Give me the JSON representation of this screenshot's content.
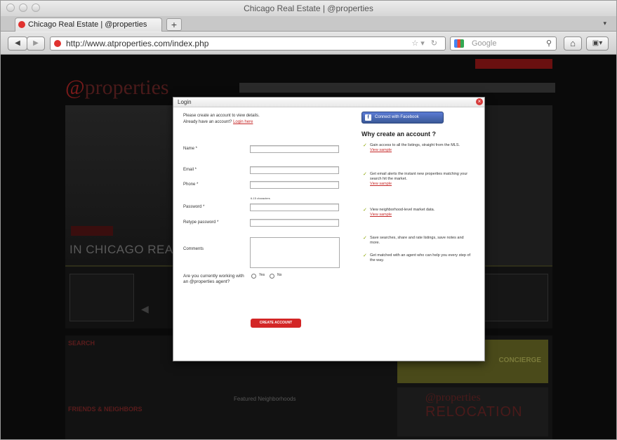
{
  "window": {
    "title": "Chicago Real Estate | @properties"
  },
  "tabs": [
    {
      "label": "Chicago Real Estate | @properties",
      "new_tab": "+"
    }
  ],
  "nav": {
    "back": "◀",
    "forward": "▶",
    "url": "http://www.atproperties.com/index.php",
    "search_placeholder": "Google",
    "home": "⌂",
    "menu": "▣▾"
  },
  "site": {
    "logo_at": "@",
    "logo_text": "properties",
    "hero_caption": "IN CHICAGO REAL",
    "section1": "SEARCH",
    "section2": "FRIENDS & NEIGHBORS",
    "featured": "Featured Neighborhoods",
    "promo": "CONCIERGE",
    "reloc1": "@properties",
    "reloc2": "RELOCATION"
  },
  "modal": {
    "title": "Login",
    "close": "×",
    "intro_line1": "Please create an account to view details.",
    "intro_line2": "Already have an account?",
    "login_link": "Login here",
    "fields": {
      "name": "Name *",
      "email": "Email *",
      "phone": "Phone *",
      "password_hint": "6-15 characters",
      "password": "Password *",
      "retype": "Retype password *",
      "comments": "Comments"
    },
    "agent_question": "Are you currently working with an @properties agent?",
    "yes": "Yes",
    "no": "No",
    "create_button": "CREATE ACCOUNT",
    "facebook": "Connect with Facebook",
    "why_title": "Why create an account ?",
    "benefits": [
      {
        "text": "Gain access to all the listings, straight from the MLS.",
        "link": "View sample"
      },
      {
        "text": "Get email alerts the instant new properties matching your search hit the market.",
        "link": "View sample"
      },
      {
        "text": "View neighborhood-level market data.",
        "link": "View sample"
      },
      {
        "text": "Save searches, share and rate listings, save notes and more.",
        "link": ""
      },
      {
        "text": "Get matched with an agent who can help you every step of the way.",
        "link": ""
      }
    ]
  },
  "colors": {
    "accent": "#d32626",
    "facebook": "#3b5998",
    "check": "#8aa400"
  }
}
